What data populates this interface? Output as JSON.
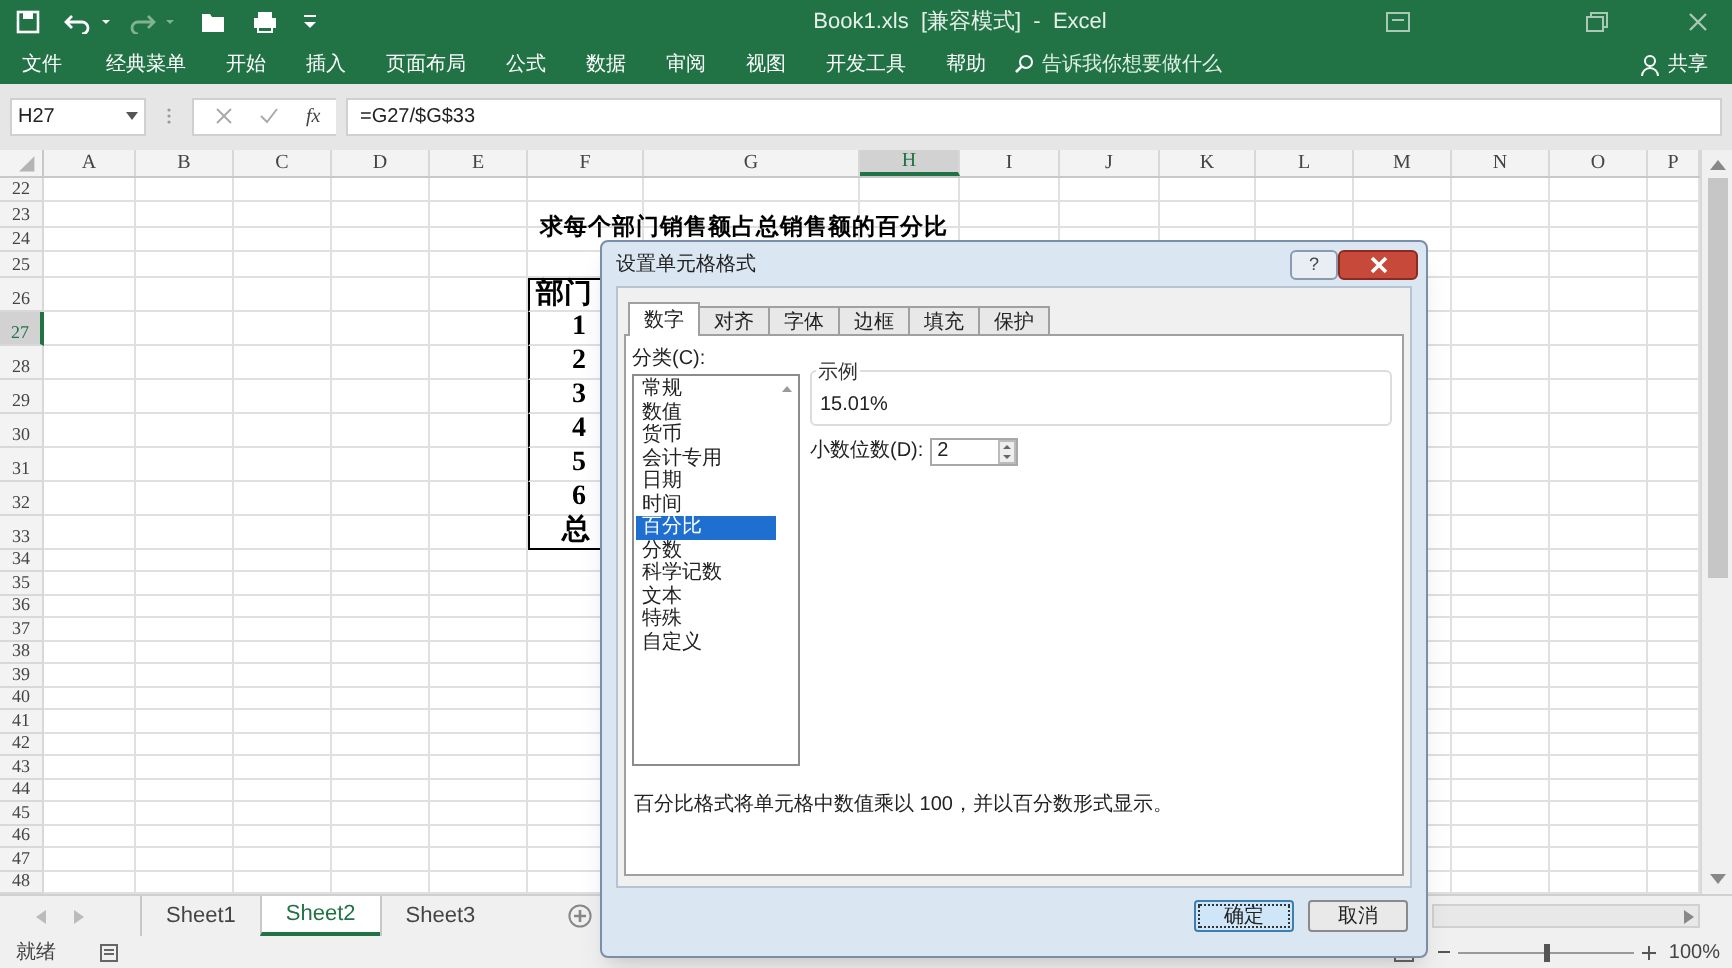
{
  "window": {
    "title": "Book1.xls  [兼容模式]  -  Excel"
  },
  "menu": [
    "文件",
    "经典菜单",
    "开始",
    "插入",
    "页面布局",
    "公式",
    "数据",
    "审阅",
    "视图",
    "开发工具",
    "帮助"
  ],
  "tell_me": {
    "placeholder": "告诉我你想要做什么"
  },
  "share": "共享",
  "formula_bar": {
    "name_box": "H27",
    "fx": "fx",
    "formula": "=G27/$G$33"
  },
  "columns": [
    {
      "label": "A",
      "selected": false
    },
    {
      "label": "B",
      "selected": false
    },
    {
      "label": "C",
      "selected": false
    },
    {
      "label": "D",
      "selected": false
    },
    {
      "label": "E",
      "selected": false
    },
    {
      "label": "F",
      "selected": false
    },
    {
      "label": "G",
      "selected": false
    },
    {
      "label": "H",
      "selected": true
    },
    {
      "label": "I",
      "selected": false
    },
    {
      "label": "J",
      "selected": false
    },
    {
      "label": "K",
      "selected": false
    },
    {
      "label": "L",
      "selected": false
    },
    {
      "label": "M",
      "selected": false
    },
    {
      "label": "N",
      "selected": false
    },
    {
      "label": "O",
      "selected": false
    },
    {
      "label": "P",
      "selected": false
    }
  ],
  "rows": [
    {
      "label": "22",
      "selected": false
    },
    {
      "label": "23",
      "selected": false
    },
    {
      "label": "24",
      "selected": false
    },
    {
      "label": "25",
      "selected": false
    },
    {
      "label": "26",
      "selected": false
    },
    {
      "label": "27",
      "selected": true
    },
    {
      "label": "28",
      "selected": false
    },
    {
      "label": "29",
      "selected": false
    },
    {
      "label": "30",
      "selected": false
    },
    {
      "label": "31",
      "selected": false
    },
    {
      "label": "32",
      "selected": false
    },
    {
      "label": "33",
      "selected": false
    },
    {
      "label": "34",
      "selected": false
    },
    {
      "label": "35",
      "selected": false
    },
    {
      "label": "36",
      "selected": false
    },
    {
      "label": "37",
      "selected": false
    },
    {
      "label": "38",
      "selected": false
    },
    {
      "label": "39",
      "selected": false
    },
    {
      "label": "40",
      "selected": false
    },
    {
      "label": "41",
      "selected": false
    },
    {
      "label": "42",
      "selected": false
    },
    {
      "label": "43",
      "selected": false
    },
    {
      "label": "44",
      "selected": false
    },
    {
      "label": "45",
      "selected": false
    },
    {
      "label": "46",
      "selected": false
    },
    {
      "label": "47",
      "selected": false
    },
    {
      "label": "48",
      "selected": false
    }
  ],
  "sheet": {
    "title": "求每个部门销售额占总销售额的百分比",
    "table_header": "部门",
    "values": [
      "1",
      "2",
      "3",
      "4",
      "5",
      "6"
    ],
    "total": "总"
  },
  "dialog": {
    "title": "设置单元格格式",
    "help": "?",
    "tabs": [
      {
        "label": "数字",
        "selected": true
      },
      {
        "label": "对齐",
        "selected": false
      },
      {
        "label": "字体",
        "selected": false
      },
      {
        "label": "边框",
        "selected": false
      },
      {
        "label": "填充",
        "selected": false
      },
      {
        "label": "保护",
        "selected": false
      }
    ],
    "category_label": "分类(C):",
    "categories": [
      {
        "label": "常规",
        "selected": false
      },
      {
        "label": "数值",
        "selected": false
      },
      {
        "label": "货币",
        "selected": false
      },
      {
        "label": "会计专用",
        "selected": false
      },
      {
        "label": "日期",
        "selected": false
      },
      {
        "label": "时间",
        "selected": false
      },
      {
        "label": "百分比",
        "selected": true
      },
      {
        "label": "分数",
        "selected": false
      },
      {
        "label": "科学记数",
        "selected": false
      },
      {
        "label": "文本",
        "selected": false
      },
      {
        "label": "特殊",
        "selected": false
      },
      {
        "label": "自定义",
        "selected": false
      }
    ],
    "sample": {
      "label": "示例",
      "value": "15.01%"
    },
    "decimal_places": {
      "label": "小数位数(D):",
      "value": "2"
    },
    "description": "百分比格式将单元格中数值乘以 100，并以百分数形式显示。",
    "buttons": [
      {
        "label": "确定",
        "default": true
      },
      {
        "label": "取消",
        "default": false
      }
    ]
  },
  "sheet_tabs": [
    {
      "label": "Sheet1",
      "selected": false
    },
    {
      "label": "Sheet2",
      "selected": true
    },
    {
      "label": "Sheet3",
      "selected": false
    }
  ],
  "status_bar": {
    "status": "就绪",
    "zoom": {
      "level": 0.5,
      "reading": "100%"
    }
  }
}
